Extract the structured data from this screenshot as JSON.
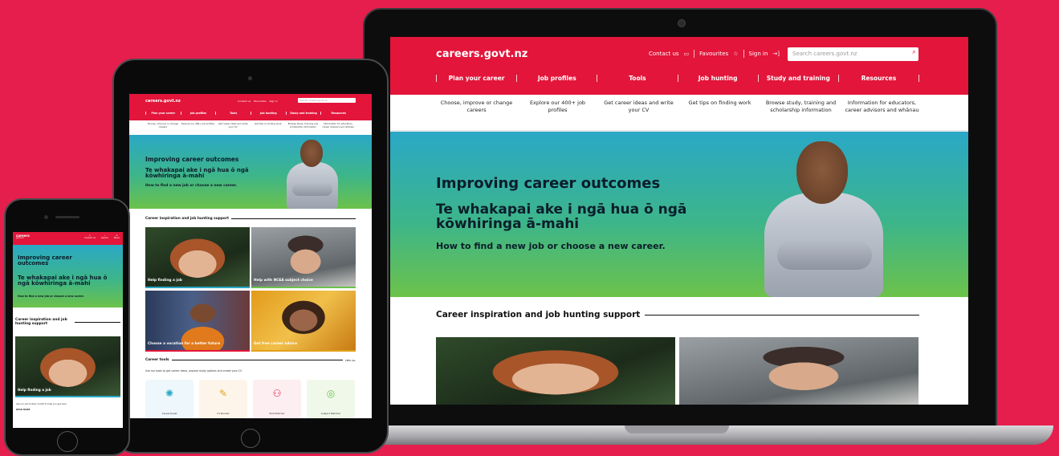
{
  "site": {
    "logo": "careers.govt.nz",
    "utility": {
      "contact": "Contact us",
      "favourites": "Favourites",
      "sign_in": "Sign in"
    },
    "search_placeholder": "Search careers.govt.nz",
    "nav": [
      "Plan your career",
      "Job profiles",
      "Tools",
      "Job hunting",
      "Study and training",
      "Resources"
    ],
    "sub_nav": [
      "Choose, improve or change careers",
      "Explore our 400+ job profiles",
      "Get career ideas and write your CV",
      "Get tips on finding work",
      "Browse study, training and scholarship information",
      "Information for educators, career advisors and whānau"
    ]
  },
  "hero": {
    "title": "Improving career outcomes",
    "maori_title": "Te whakapai ake i ngā hua ō ngā kōwhiringa ā-mahi",
    "subtitle": "How to find a new job or choose a new career."
  },
  "inspiration": {
    "heading": "Career inspiration and job hunting support",
    "cards": [
      "Help finding a job",
      "Help with NCEA subject choice",
      "Choose a vocation for a better future",
      "Get free career advice"
    ]
  },
  "tools": {
    "heading": "Career tools",
    "view_all": "VIEW ALL",
    "description": "Use our tools to get career ideas, explore study options and create your CV",
    "items": [
      "CareerQuest",
      "CV Builder",
      "Skill Matcher",
      "Subject Matcher"
    ]
  },
  "phone": {
    "logo_line1": "careers",
    "logo_line2": "govt.nz",
    "icons": [
      "Contact us",
      "Search",
      "Menu"
    ],
    "card_desc": "Use our job hunters' toolkit to help you get work",
    "read_more": "READ MORE"
  },
  "colors": {
    "brand_red": "#e3153a",
    "page_bg": "#e61e4d",
    "hero_top": "#2aa8c6",
    "hero_bottom": "#6cc24a"
  }
}
